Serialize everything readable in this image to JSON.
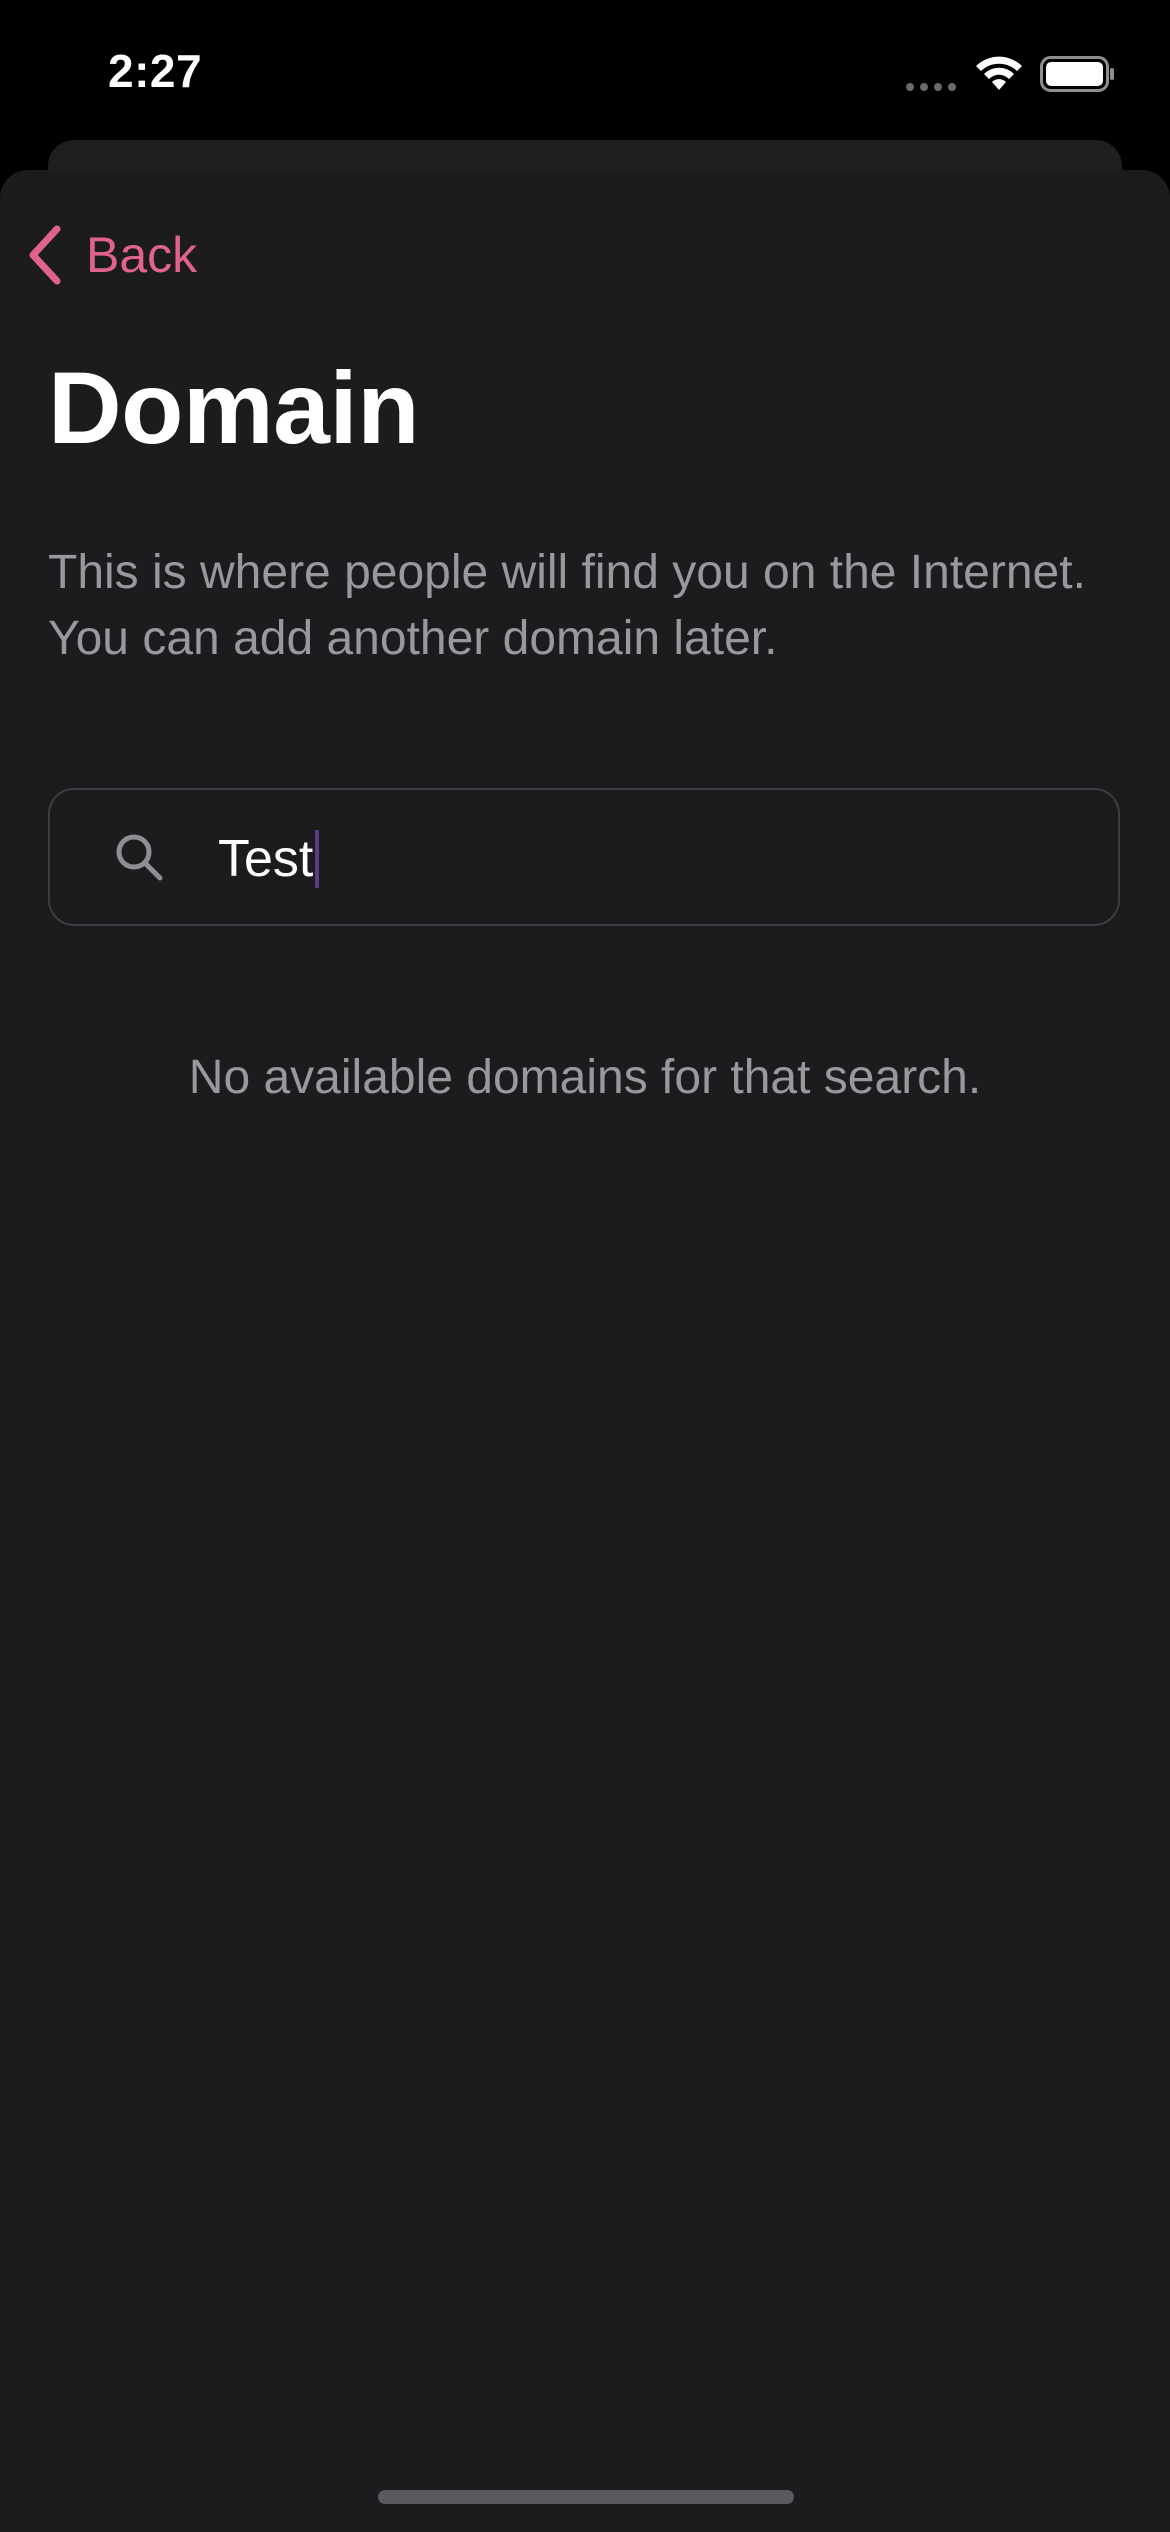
{
  "status_bar": {
    "time": "2:27"
  },
  "navigation": {
    "back_label": "Back"
  },
  "page": {
    "title": "Domain",
    "description": "This is where people will find you on the Internet. You can add another domain later."
  },
  "search": {
    "value": "Test"
  },
  "results": {
    "empty_message": "No available domains for that search."
  },
  "colors": {
    "accent": "#e0628f",
    "background": "#1c1c1e",
    "secondary_text": "#98989d"
  },
  "icons": {
    "back": "chevron-left-icon",
    "search": "magnifying-glass-icon",
    "wifi": "wifi-icon",
    "battery": "battery-icon",
    "signal": "cellular-signal-icon"
  }
}
